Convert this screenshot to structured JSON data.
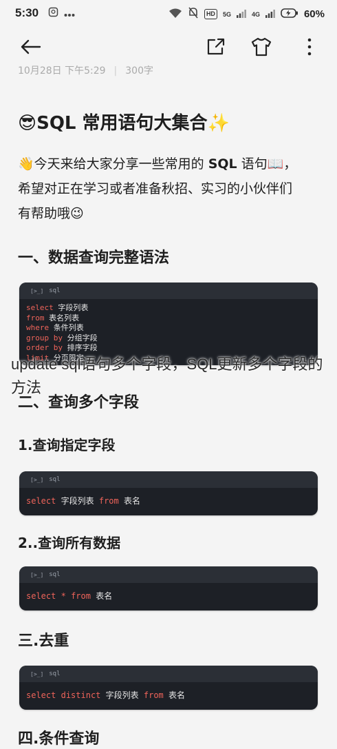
{
  "status_bar": {
    "time": "5:30",
    "network_labels": [
      "5G",
      "4G"
    ],
    "hd_label": "HD",
    "battery_percent": "60%"
  },
  "app_bar": {
    "icons": [
      "back-arrow-icon",
      "share-icon",
      "tshirt-icon",
      "more-vertical-icon"
    ]
  },
  "article": {
    "meta_date": "10月28日 下午5:29",
    "meta_words": "300字",
    "title": "😎SQL 常用语句大集合✨",
    "intro_line1_pre": "👋今天来给大家分享一些常用的 ",
    "intro_line1_bold": "SQL",
    "intro_line1_post": " 语句📖，",
    "intro_line2": "希望对正在学习或者准备秋招、实习的小伙伴们",
    "intro_line3": "有帮助哦😉",
    "section1": "一、数据查询完整语法",
    "section2": "二、查询多个字段",
    "sub1": "1.查询指定字段",
    "sub2": "2..查询所有数据",
    "section3": "三.去重",
    "section4": "四.条件查询"
  },
  "code_blocks": {
    "lang_label": "sql",
    "block1": [
      {
        "kw": "select",
        "text": "字段列表"
      },
      {
        "kw": "from",
        "text": "表名列表"
      },
      {
        "kw": "where",
        "text": "条件列表"
      },
      {
        "kw": "group by",
        "text": "分组字段"
      },
      {
        "kw": "order by",
        "text": "排序字段"
      },
      {
        "kw": "limit",
        "text": "分页限定"
      }
    ],
    "block2": {
      "kw1": "select",
      "mid": "字段列表",
      "kw2": "from",
      "tail": "表名"
    },
    "block3": {
      "kw1": "select",
      "mid": "*",
      "kw2": "from",
      "tail": "表名"
    },
    "block4": {
      "kw1": "select",
      "kw_extra": "distinct",
      "mid": "字段列表",
      "kw2": "from",
      "tail": "表名"
    }
  },
  "overlay_caption": "update sql语句多个字段，SQL更新多个字段的方法",
  "colors": {
    "background": "#f4f4f4",
    "code_bg": "#1d2026",
    "code_header": "#2b2f36",
    "keyword": "#f0645a"
  }
}
